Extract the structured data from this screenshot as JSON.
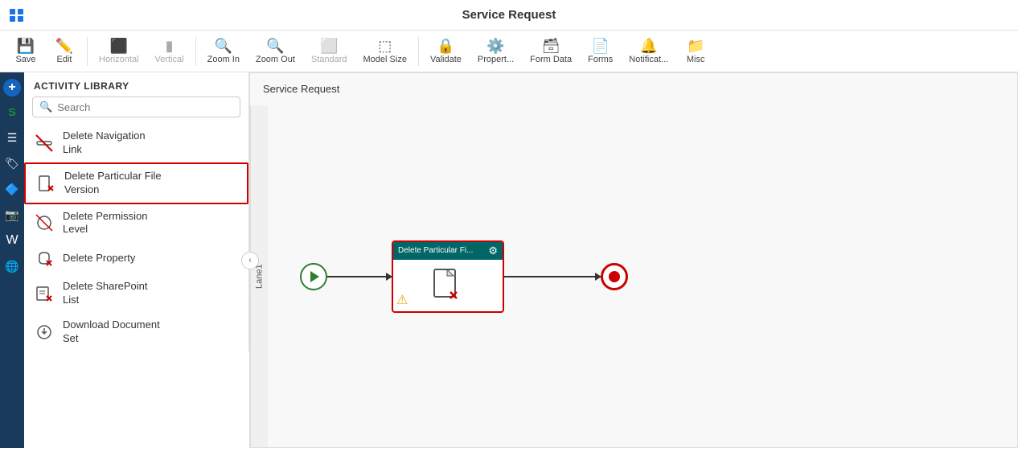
{
  "app": {
    "title": "Service Request"
  },
  "toolbar": {
    "save_label": "Save",
    "edit_label": "Edit",
    "horizontal_label": "Horizontal",
    "vertical_label": "Vertical",
    "zoom_in_label": "Zoom In",
    "zoom_out_label": "Zoom Out",
    "standard_label": "Standard",
    "model_size_label": "Model Size",
    "validate_label": "Validate",
    "properties_label": "Propert...",
    "form_data_label": "Form Data",
    "forms_label": "Forms",
    "notifications_label": "Notificat...",
    "misc_label": "Misc"
  },
  "activity_library": {
    "header": "ACTIVITY LIBRARY",
    "search_placeholder": "Search",
    "items": [
      {
        "id": "delete-nav-link",
        "label": "Delete Navigation Link",
        "icon": "🔗",
        "selected": false
      },
      {
        "id": "delete-particular-file",
        "label": "Delete Particular File Version",
        "icon": "📄",
        "selected": true
      },
      {
        "id": "delete-permission",
        "label": "Delete Permission Level",
        "icon": "🛡",
        "selected": false
      },
      {
        "id": "delete-property",
        "label": "Delete Property",
        "icon": "🔒",
        "selected": false
      },
      {
        "id": "delete-sharepoint",
        "label": "Delete SharePoint List",
        "icon": "📋",
        "selected": false
      },
      {
        "id": "download-doc-set",
        "label": "Download Document Set",
        "icon": "⚙",
        "selected": false
      }
    ]
  },
  "canvas": {
    "label": "Service Request",
    "lane_label": "Lane1",
    "node": {
      "title": "Delete Particular Fi...",
      "warning_icon": "⚠",
      "delete_icon": "✕"
    }
  },
  "colors": {
    "accent_blue": "#1a73e8",
    "sidebar_bg": "#1a3a5c",
    "teal": "#006666",
    "red": "#cc0000",
    "green": "#2e7d32"
  }
}
